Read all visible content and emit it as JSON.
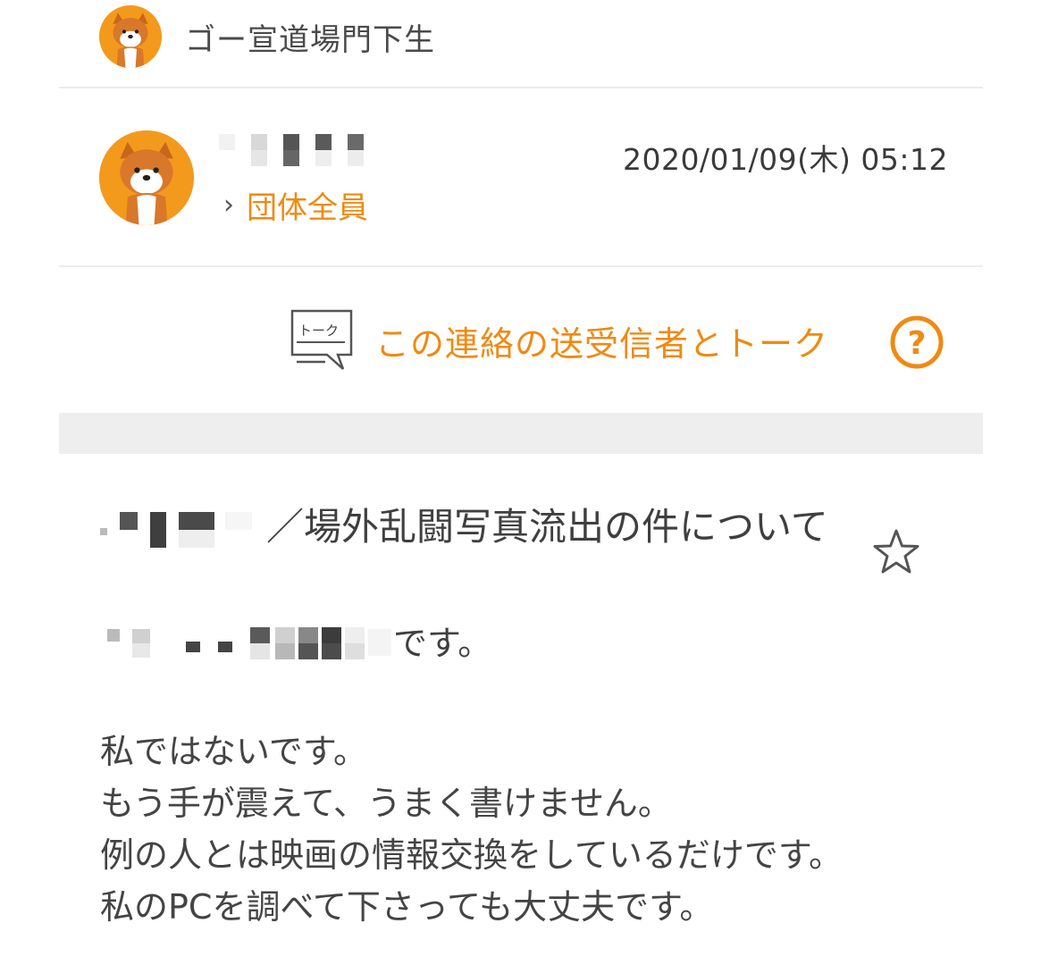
{
  "group": {
    "name": "ゴー宣道場門下生"
  },
  "message": {
    "datetime": "2020/01/09(木) 05:12",
    "recipient": "団体全員",
    "talk_label": "この連絡の送受信者とトーク",
    "talk_icon_text": "トーク",
    "subject_text": "／場外乱闘写真流出の件について",
    "intro_suffix": "です。",
    "body_lines": [
      "私ではないです。",
      "もう手が震えて、うまく書けません。",
      "例の人とは映画の情報交換をしているだけです。",
      "私のPCを調べて下さっても大丈夫です。"
    ]
  },
  "icons": {
    "avatar": "shiba-dog-icon",
    "talk": "talk-bubble-icon",
    "help": "help-circle-icon",
    "star": "star-outline-icon",
    "chevron": "chevron-right-icon"
  },
  "colors": {
    "accent": "#ef8a12",
    "avatar_bg": "#f39a1c",
    "divider": "#ececec"
  }
}
